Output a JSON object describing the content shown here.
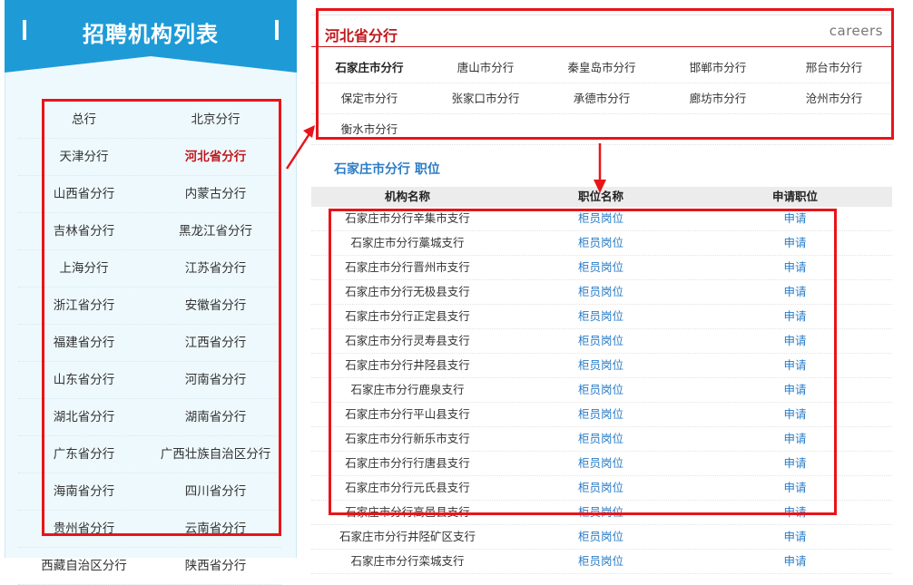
{
  "sidebar": {
    "title": "招聘机构列表",
    "rows": [
      [
        "总行",
        "北京分行"
      ],
      [
        "天津分行",
        "河北省分行"
      ],
      [
        "山西省分行",
        "内蒙古分行"
      ],
      [
        "吉林省分行",
        "黑龙江省分行"
      ],
      [
        "上海分行",
        "江苏省分行"
      ],
      [
        "浙江省分行",
        "安徽省分行"
      ],
      [
        "福建省分行",
        "江西省分行"
      ],
      [
        "山东省分行",
        "河南省分行"
      ],
      [
        "湖北省分行",
        "湖南省分行"
      ],
      [
        "广东省分行",
        "广西壮族自治区分行"
      ],
      [
        "海南省分行",
        "四川省分行"
      ],
      [
        "贵州省分行",
        "云南省分行"
      ],
      [
        "西藏自治区分行",
        "陕西省分行"
      ]
    ],
    "active": "河北省分行"
  },
  "branch": {
    "title": "河北省分行",
    "careers": "careers",
    "cities": [
      [
        "石家庄市分行",
        "唐山市分行",
        "秦皇岛市分行",
        "邯郸市分行",
        "邢台市分行"
      ],
      [
        "保定市分行",
        "张家口市分行",
        "承德市分行",
        "廊坊市分行",
        "沧州市分行"
      ],
      [
        "衡水市分行"
      ]
    ],
    "active_city": "石家庄市分行"
  },
  "positions": {
    "section_title": "石家庄市分行 职位",
    "headers": [
      "机构名称",
      "职位名称",
      "申请职位"
    ],
    "rows": [
      [
        "石家庄市分行辛集市支行",
        "柜员岗位",
        "申请"
      ],
      [
        "石家庄市分行藁城支行",
        "柜员岗位",
        "申请"
      ],
      [
        "石家庄市分行晋州市支行",
        "柜员岗位",
        "申请"
      ],
      [
        "石家庄市分行无极县支行",
        "柜员岗位",
        "申请"
      ],
      [
        "石家庄市分行正定县支行",
        "柜员岗位",
        "申请"
      ],
      [
        "石家庄市分行灵寿县支行",
        "柜员岗位",
        "申请"
      ],
      [
        "石家庄市分行井陉县支行",
        "柜员岗位",
        "申请"
      ],
      [
        "石家庄市分行鹿泉支行",
        "柜员岗位",
        "申请"
      ],
      [
        "石家庄市分行平山县支行",
        "柜员岗位",
        "申请"
      ],
      [
        "石家庄市分行新乐市支行",
        "柜员岗位",
        "申请"
      ],
      [
        "石家庄市分行行唐县支行",
        "柜员岗位",
        "申请"
      ],
      [
        "石家庄市分行元氏县支行",
        "柜员岗位",
        "申请"
      ],
      [
        "石家庄市分行高邑县支行",
        "柜员岗位",
        "申请"
      ],
      [
        "石家庄市分行井陉矿区支行",
        "柜员岗位",
        "申请"
      ],
      [
        "石家庄市分行栾城支行",
        "柜员岗位",
        "申请"
      ]
    ]
  },
  "colors": {
    "header_blue": "#1e9bd7",
    "highlight_red": "#e8141a",
    "active_red": "#c0171c",
    "link_blue": "#2a7cc7"
  }
}
